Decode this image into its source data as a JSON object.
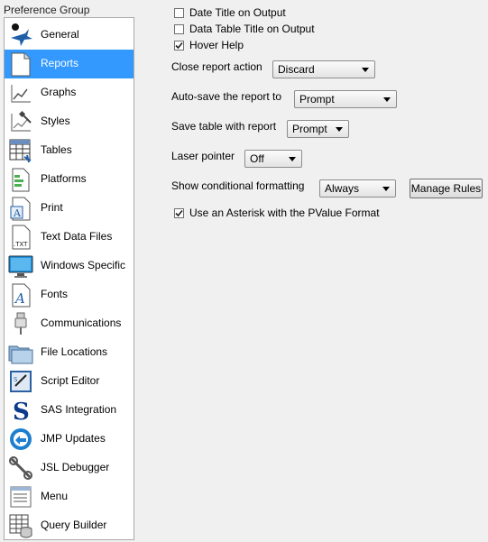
{
  "sidebar": {
    "header": "Preference Group",
    "items": [
      {
        "label": "General",
        "icon": "general-icon",
        "selected": false
      },
      {
        "label": "Reports",
        "icon": "reports-icon",
        "selected": true
      },
      {
        "label": "Graphs",
        "icon": "graphs-icon",
        "selected": false
      },
      {
        "label": "Styles",
        "icon": "styles-icon",
        "selected": false
      },
      {
        "label": "Tables",
        "icon": "tables-icon",
        "selected": false
      },
      {
        "label": "Platforms",
        "icon": "platforms-icon",
        "selected": false
      },
      {
        "label": "Print",
        "icon": "print-icon",
        "selected": false
      },
      {
        "label": "Text Data Files",
        "icon": "text-data-files-icon",
        "selected": false
      },
      {
        "label": "Windows Specific",
        "icon": "windows-specific-icon",
        "selected": false
      },
      {
        "label": "Fonts",
        "icon": "fonts-icon",
        "selected": false
      },
      {
        "label": "Communications",
        "icon": "communications-icon",
        "selected": false
      },
      {
        "label": "File Locations",
        "icon": "file-locations-icon",
        "selected": false
      },
      {
        "label": "Script Editor",
        "icon": "script-editor-icon",
        "selected": false
      },
      {
        "label": "SAS Integration",
        "icon": "sas-integration-icon",
        "selected": false
      },
      {
        "label": "JMP Updates",
        "icon": "jmp-updates-icon",
        "selected": false
      },
      {
        "label": "JSL Debugger",
        "icon": "jsl-debugger-icon",
        "selected": false
      },
      {
        "label": "Menu",
        "icon": "menu-icon",
        "selected": false
      },
      {
        "label": "Query Builder",
        "icon": "query-builder-icon",
        "selected": false
      }
    ]
  },
  "options": {
    "date_title": {
      "label": "Date Title on Output",
      "checked": false
    },
    "data_table_title": {
      "label": "Data Table Title on Output",
      "checked": false
    },
    "hover_help": {
      "label": "Hover Help",
      "checked": true
    },
    "close_report_action": {
      "label": "Close report action",
      "value": "Discard"
    },
    "auto_save": {
      "label": "Auto-save the report to",
      "value": "Prompt"
    },
    "save_table": {
      "label": "Save table with report",
      "value": "Prompt"
    },
    "laser_pointer": {
      "label": "Laser pointer",
      "value": "Off"
    },
    "conditional_formatting": {
      "label": "Show conditional formatting",
      "value": "Always"
    },
    "manage_rules_button": "Manage Rules",
    "pvalue_asterisk": {
      "label": "Use an Asterisk with the PValue Format",
      "checked": true
    }
  },
  "colors": {
    "selection": "#3399ff",
    "background": "#f0f0f0"
  }
}
